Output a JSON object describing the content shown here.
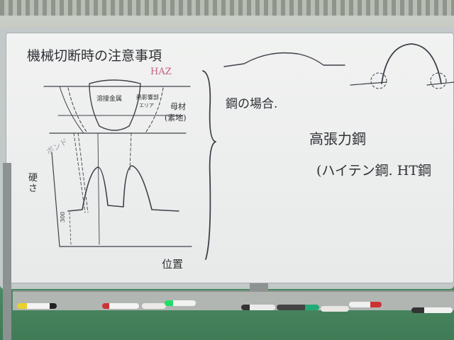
{
  "whiteboard": {
    "title": "機械切断時の注意事項",
    "haz_label": "HAZ",
    "weld_metal_label": "溶接金属",
    "heat_affected_label": "熱影響部",
    "zone_label": "エリア",
    "base_metal_label": "母材",
    "base_metal_sub": "(素地)",
    "bond_label": "ボンド",
    "hardness_label": "硬さ",
    "axis_value_label": "300",
    "position_label": "位置",
    "steel_case": "鋼の場合.",
    "high_tensile": "高張力鋼",
    "hiten_line": "(ハイテン鋼. HT鋼"
  },
  "colors": {
    "ink": "#3d4049",
    "haz_ink": "#c0607a",
    "board": "#eef0ef",
    "floor": "#4f8f66"
  }
}
